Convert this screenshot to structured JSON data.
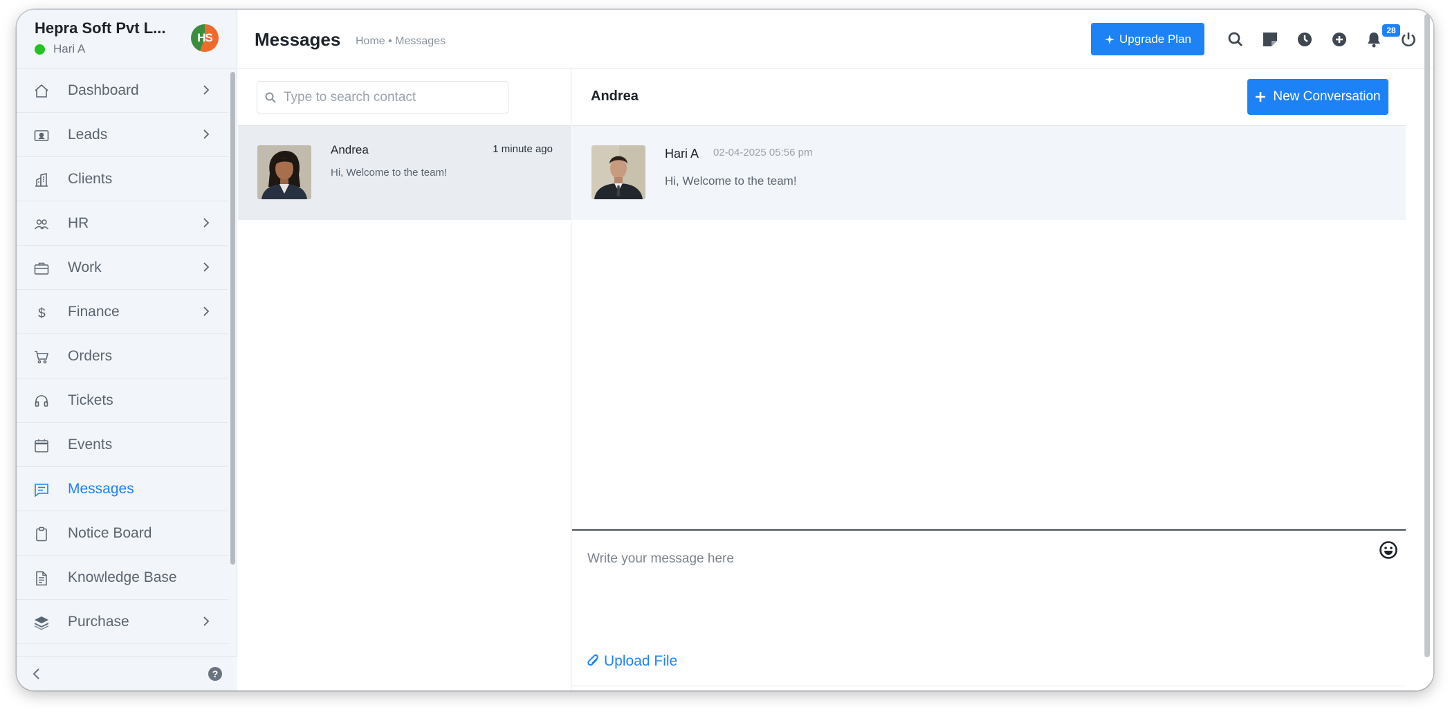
{
  "brand": {
    "company": "Hepra Soft Pvt L...",
    "user": "Hari A",
    "logo_text": "HS",
    "status_color": "#22c322"
  },
  "sidebar": {
    "items": [
      {
        "label": "Dashboard",
        "icon": "home-icon",
        "has_submenu": true
      },
      {
        "label": "Leads",
        "icon": "contact-card-icon",
        "has_submenu": true
      },
      {
        "label": "Clients",
        "icon": "building-icon",
        "has_submenu": false
      },
      {
        "label": "HR",
        "icon": "people-icon",
        "has_submenu": true
      },
      {
        "label": "Work",
        "icon": "briefcase-icon",
        "has_submenu": true
      },
      {
        "label": "Finance",
        "icon": "dollar-icon",
        "has_submenu": true
      },
      {
        "label": "Orders",
        "icon": "cart-icon",
        "has_submenu": false
      },
      {
        "label": "Tickets",
        "icon": "headset-icon",
        "has_submenu": false
      },
      {
        "label": "Events",
        "icon": "calendar-icon",
        "has_submenu": false
      },
      {
        "label": "Messages",
        "icon": "message-icon",
        "has_submenu": false,
        "active": true
      },
      {
        "label": "Notice Board",
        "icon": "clipboard-icon",
        "has_submenu": false
      },
      {
        "label": "Knowledge Base",
        "icon": "document-icon",
        "has_submenu": false
      },
      {
        "label": "Purchase",
        "icon": "layers-icon",
        "has_submenu": true
      }
    ]
  },
  "header": {
    "title": "Messages",
    "breadcrumb": "Home • Messages",
    "upgrade_label": "Upgrade Plan",
    "notification_count": "28",
    "accent_color": "#1d82f5"
  },
  "contacts": {
    "search_placeholder": "Type to search contact",
    "list": [
      {
        "name": "Andrea",
        "time": "1 minute ago",
        "preview": "Hi, Welcome to the team!"
      }
    ]
  },
  "conversation": {
    "recipient": "Andrea",
    "new_button_label": "New Conversation",
    "messages": [
      {
        "sender": "Hari A",
        "date": "02-04-2025 05:56 pm",
        "text": "Hi, Welcome to the team!"
      }
    ],
    "composer_placeholder": "Write your message here",
    "upload_label": "Upload File"
  }
}
